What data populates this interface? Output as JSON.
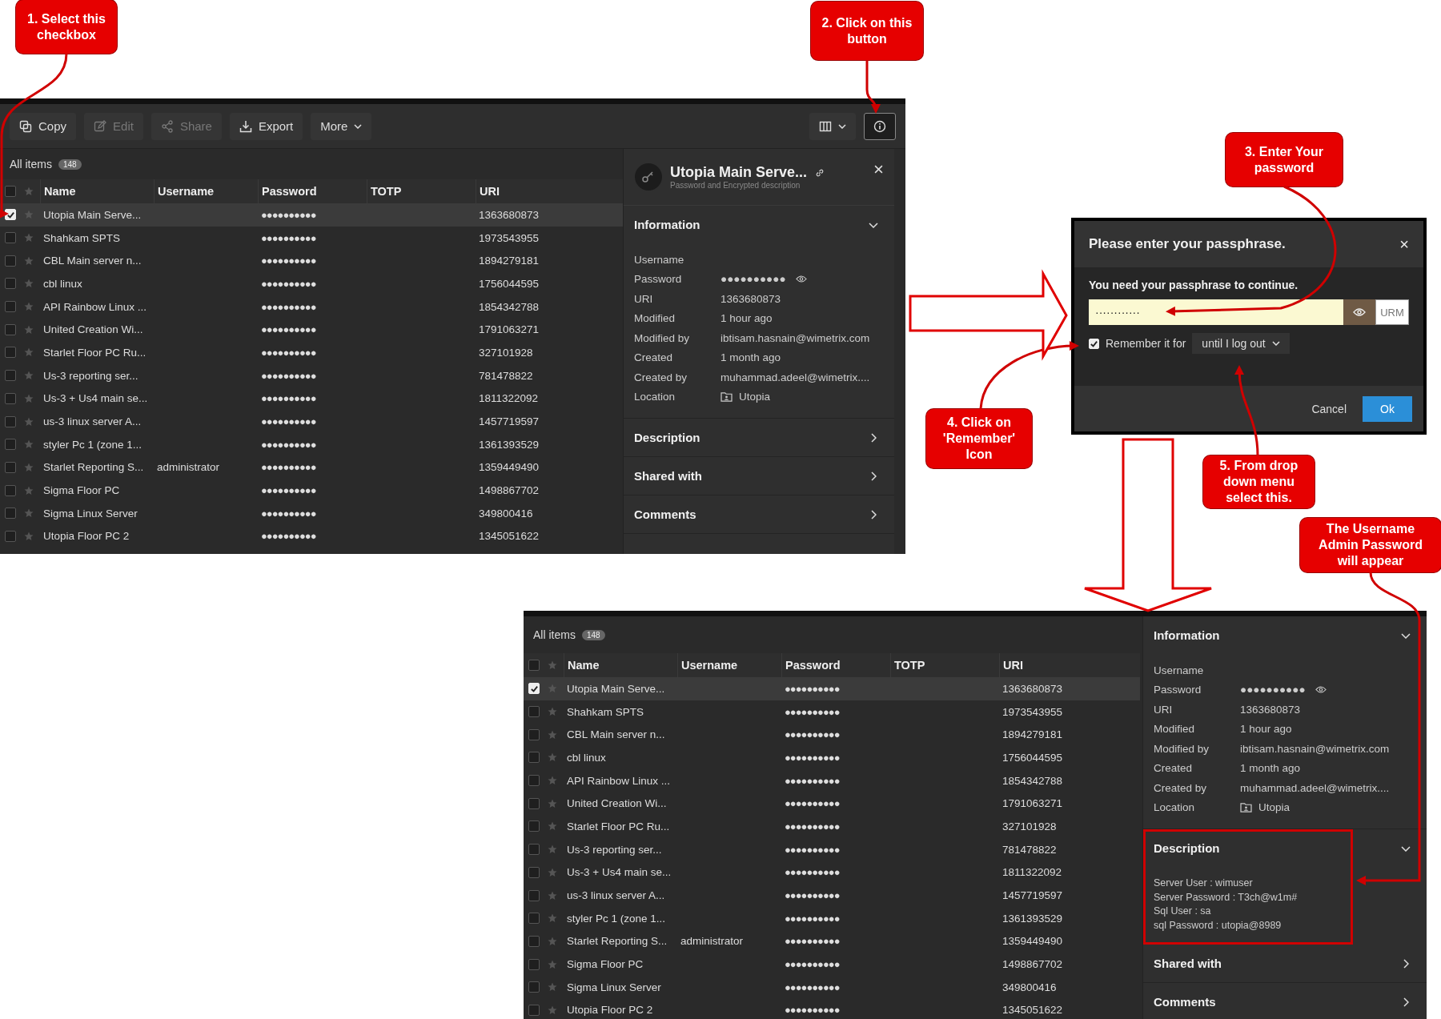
{
  "callouts": [
    {
      "text": "1. Select this checkbox"
    },
    {
      "text": "2. Click on this button"
    },
    {
      "text": "3. Enter Your password"
    },
    {
      "text": "4. Click on 'Remember' Icon"
    },
    {
      "text": "5. From drop down menu select this."
    },
    {
      "text": "The Username Admin Password will appear"
    }
  ],
  "screenshots": [
    {
      "toolbar": {
        "buttons": [
          {
            "label": "Copy",
            "kind": "copy",
            "disabled": false
          },
          {
            "label": "Edit",
            "kind": "edit",
            "disabled": true
          },
          {
            "label": "Share",
            "kind": "share",
            "disabled": true
          },
          {
            "label": "Export",
            "kind": "export",
            "disabled": false
          },
          {
            "label": "More",
            "kind": "more",
            "disabled": false
          }
        ]
      },
      "list": {
        "title": "All items",
        "count": "148",
        "all_selected": false,
        "columns": [
          "Name",
          "Username",
          "Password",
          "TOTP",
          "URI"
        ],
        "rows": [
          {
            "selected": true,
            "name": "Utopia Main Serve...",
            "password": "●●●●●●●●●●",
            "uri": "1363680873"
          },
          {
            "selected": false,
            "name": "Shahkam SPTS",
            "password": "●●●●●●●●●●",
            "uri": "1973543955"
          },
          {
            "selected": false,
            "name": "CBL Main server n...",
            "password": "●●●●●●●●●●",
            "uri": "1894279181"
          },
          {
            "selected": false,
            "name": "cbl linux",
            "password": "●●●●●●●●●●",
            "uri": "1756044595"
          },
          {
            "selected": false,
            "name": "API Rainbow Linux ...",
            "password": "●●●●●●●●●●",
            "uri": "1854342788"
          },
          {
            "selected": false,
            "name": "United Creation Wi...",
            "password": "●●●●●●●●●●",
            "uri": "1791063271"
          },
          {
            "selected": false,
            "name": "Starlet Floor PC Ru...",
            "password": "●●●●●●●●●●",
            "uri": "327101928"
          },
          {
            "selected": false,
            "name": "Us-3 reporting ser...",
            "password": "●●●●●●●●●●",
            "uri": "781478822"
          },
          {
            "selected": false,
            "name": "Us-3 + Us4 main se...",
            "password": "●●●●●●●●●●",
            "uri": "1811322092"
          },
          {
            "selected": false,
            "name": "us-3 linux server A...",
            "password": "●●●●●●●●●●",
            "uri": "1457719597"
          },
          {
            "selected": false,
            "name": "styler Pc 1 (zone 1...",
            "password": "●●●●●●●●●●",
            "uri": "1361393529"
          },
          {
            "selected": false,
            "name": "Starlet Reporting S...",
            "username": "administrator",
            "password": "●●●●●●●●●●",
            "uri": "1359449490"
          },
          {
            "selected": false,
            "name": "Sigma Floor PC",
            "password": "●●●●●●●●●●",
            "uri": "1498867702"
          },
          {
            "selected": false,
            "name": "Sigma Linux Server",
            "password": "●●●●●●●●●●",
            "uri": "349800416"
          },
          {
            "selected": false,
            "name": "Utopia Floor PC 2",
            "password": "●●●●●●●●●●",
            "uri": "1345051622"
          }
        ]
      },
      "detail": {
        "header": {
          "title": "Utopia Main Serve...",
          "subtitle": "Password and Encrypted description"
        },
        "sections": [
          {
            "title": "Information",
            "expanded": true,
            "highlighted": false,
            "fields": [
              {
                "label": "Username",
                "kind": "text"
              },
              {
                "label": "Password",
                "value": "●●●●●●●●●●",
                "kind": "password"
              },
              {
                "label": "URI",
                "value": "1363680873",
                "kind": "text"
              },
              {
                "label": "Modified",
                "value": "1 hour ago",
                "kind": "text"
              },
              {
                "label": "Modified by",
                "value": "ibtisam.hasnain@wimetrix.com",
                "kind": "text"
              },
              {
                "label": "Created",
                "value": "1 month ago",
                "kind": "text"
              },
              {
                "label": "Created by",
                "value": "muhammad.adeel@wimetrix....",
                "kind": "text"
              },
              {
                "label": "Location",
                "value": "Utopia",
                "kind": "location"
              }
            ]
          },
          {
            "title": "Description",
            "expanded": false,
            "highlighted": false
          },
          {
            "title": "Shared with",
            "expanded": false,
            "highlighted": false
          },
          {
            "title": "Comments",
            "expanded": false,
            "highlighted": false
          }
        ]
      }
    },
    {
      "list": {
        "title": "All items",
        "count": "148",
        "all_selected": false,
        "columns": [
          "Name",
          "Username",
          "Password",
          "TOTP",
          "URI"
        ],
        "rows": [
          {
            "selected": true,
            "name": "Utopia Main Serve...",
            "password": "●●●●●●●●●●",
            "uri": "1363680873"
          },
          {
            "selected": false,
            "name": "Shahkam SPTS",
            "password": "●●●●●●●●●●",
            "uri": "1973543955"
          },
          {
            "selected": false,
            "name": "CBL Main server n...",
            "password": "●●●●●●●●●●",
            "uri": "1894279181"
          },
          {
            "selected": false,
            "name": "cbl linux",
            "password": "●●●●●●●●●●",
            "uri": "1756044595"
          },
          {
            "selected": false,
            "name": "API Rainbow Linux ...",
            "password": "●●●●●●●●●●",
            "uri": "1854342788"
          },
          {
            "selected": false,
            "name": "United Creation Wi...",
            "password": "●●●●●●●●●●",
            "uri": "1791063271"
          },
          {
            "selected": false,
            "name": "Starlet Floor PC Ru...",
            "password": "●●●●●●●●●●",
            "uri": "327101928"
          },
          {
            "selected": false,
            "name": "Us-3 reporting ser...",
            "password": "●●●●●●●●●●",
            "uri": "781478822"
          },
          {
            "selected": false,
            "name": "Us-3 + Us4 main se...",
            "password": "●●●●●●●●●●",
            "uri": "1811322092"
          },
          {
            "selected": false,
            "name": "us-3 linux server A...",
            "password": "●●●●●●●●●●",
            "uri": "1457719597"
          },
          {
            "selected": false,
            "name": "styler Pc 1 (zone 1...",
            "password": "●●●●●●●●●●",
            "uri": "1361393529"
          },
          {
            "selected": false,
            "name": "Starlet Reporting S...",
            "username": "administrator",
            "password": "●●●●●●●●●●",
            "uri": "1359449490"
          },
          {
            "selected": false,
            "name": "Sigma Floor PC",
            "password": "●●●●●●●●●●",
            "uri": "1498867702"
          },
          {
            "selected": false,
            "name": "Sigma Linux Server",
            "password": "●●●●●●●●●●",
            "uri": "349800416"
          },
          {
            "selected": false,
            "name": "Utopia Floor PC 2",
            "password": "●●●●●●●●●●",
            "uri": "1345051622"
          }
        ]
      },
      "detail": {
        "sections": [
          {
            "title": "Information",
            "expanded": true,
            "highlighted": false,
            "fields": [
              {
                "label": "Username",
                "kind": "text"
              },
              {
                "label": "Password",
                "value": "●●●●●●●●●●",
                "kind": "password"
              },
              {
                "label": "URI",
                "value": "1363680873",
                "kind": "text"
              },
              {
                "label": "Modified",
                "value": "1 hour ago",
                "kind": "text"
              },
              {
                "label": "Modified by",
                "value": "ibtisam.hasnain@wimetrix.com",
                "kind": "text"
              },
              {
                "label": "Created",
                "value": "1 month ago",
                "kind": "text"
              },
              {
                "label": "Created by",
                "value": "muhammad.adeel@wimetrix....",
                "kind": "text"
              },
              {
                "label": "Location",
                "value": "Utopia",
                "kind": "location"
              }
            ]
          },
          {
            "title": "Description",
            "expanded": true,
            "highlighted": true,
            "lines": [
              "Server User : wimuser",
              "Server Password : T3ch@w1m#",
              "Sql User : sa",
              "sql Password : utopia@8989"
            ]
          },
          {
            "title": "Shared with",
            "expanded": false,
            "highlighted": false
          },
          {
            "title": "Comments",
            "expanded": false,
            "highlighted": false
          }
        ]
      }
    }
  ],
  "dialog": {
    "title": "Please enter your passphrase.",
    "close": "×",
    "message": "You need your passphrase to continue.",
    "passphrase": "············",
    "extension": "URM",
    "remember": {
      "checked": true,
      "label": "Remember it for",
      "duration": "until I log out"
    },
    "buttons": [
      "Cancel",
      "Ok"
    ]
  }
}
